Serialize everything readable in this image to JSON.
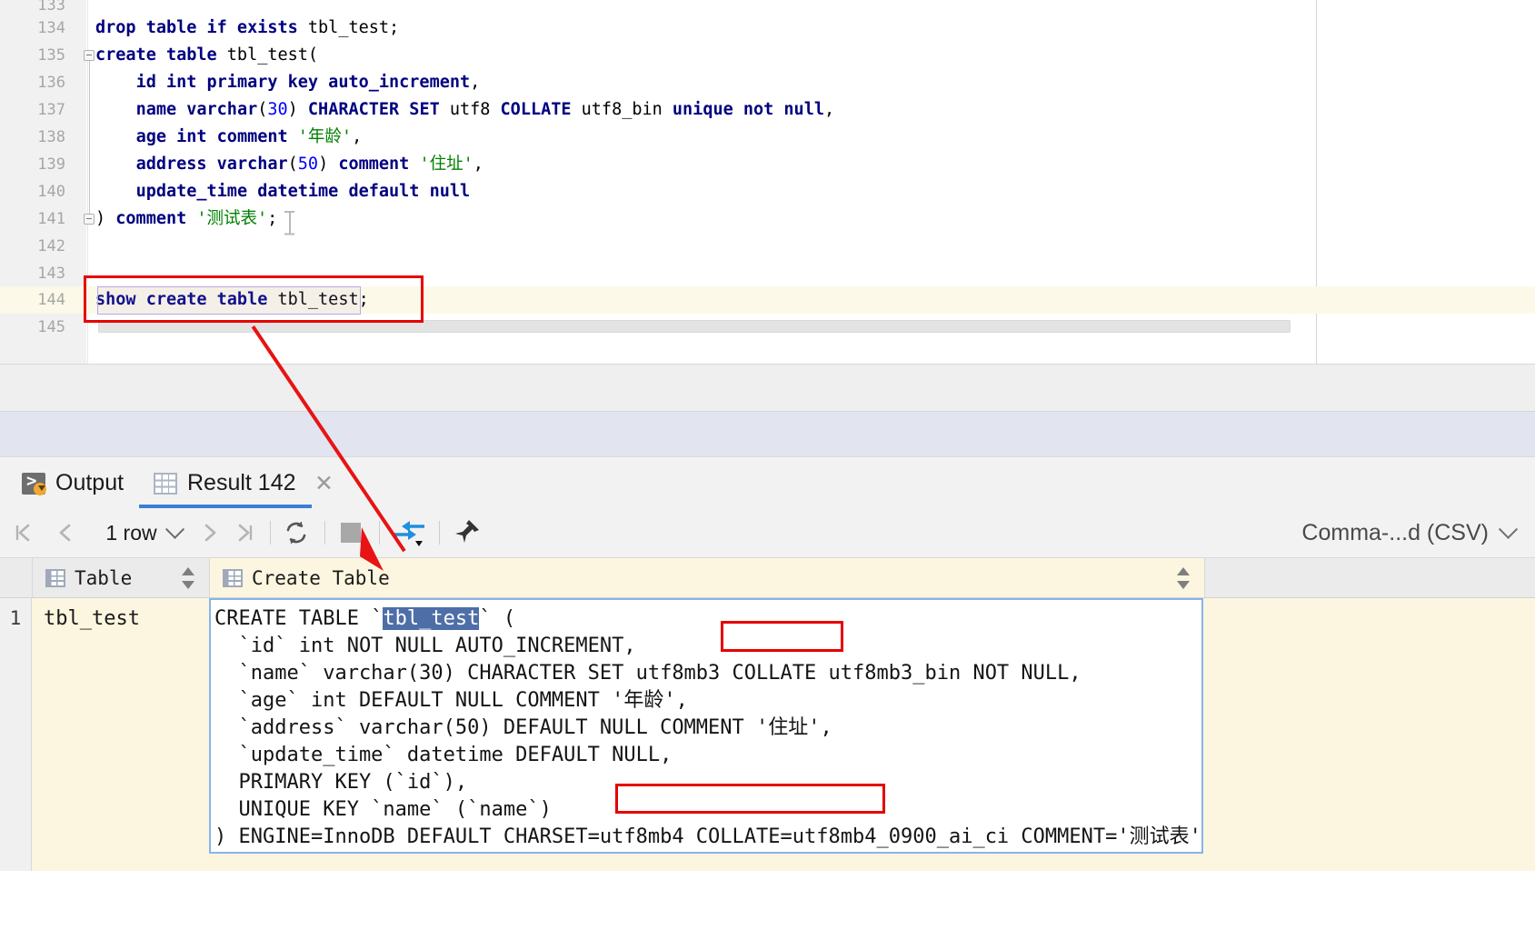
{
  "editor": {
    "lines": [
      {
        "n": "133",
        "text": ""
      },
      {
        "n": "134",
        "text": "drop table if exists tbl_test;"
      },
      {
        "n": "135",
        "text": "create table tbl_test("
      },
      {
        "n": "136",
        "text": "    id int primary key auto_increment,"
      },
      {
        "n": "137",
        "text": "    name varchar(30) CHARACTER SET utf8 COLLATE utf8_bin unique not null,"
      },
      {
        "n": "138",
        "text": "    age int comment '年龄',"
      },
      {
        "n": "139",
        "text": "    address varchar(50) comment '住址',"
      },
      {
        "n": "140",
        "text": "    update_time datetime default null"
      },
      {
        "n": "141",
        "text": ") comment '测试表';"
      },
      {
        "n": "142",
        "text": ""
      },
      {
        "n": "143",
        "text": ""
      },
      {
        "n": "144",
        "text": "show create table tbl_test;"
      },
      {
        "n": "145",
        "text": ""
      }
    ],
    "highlighted_line_number": "144",
    "highlighted_statement": "show create table tbl_test;"
  },
  "tabs": [
    {
      "label": "Output",
      "icon": "console-output-icon",
      "active": false,
      "closable": false
    },
    {
      "label": "Result 142",
      "icon": "grid-table-icon",
      "active": true,
      "closable": true,
      "close_glyph": "✕"
    }
  ],
  "result_toolbar": {
    "first_page_glyph": "|‹",
    "prev_page_glyph": "‹",
    "row_count_label": "1 row",
    "next_page_glyph": "›",
    "last_page_glyph": "›|",
    "refresh_icon": "refresh-icon",
    "stop_icon": "stop-icon",
    "transpose_icon": "import-export-icon",
    "pin_icon": "pin-icon",
    "export_format": "Comma-...d (CSV)",
    "export_chevron": "⌄"
  },
  "result_table": {
    "columns": [
      {
        "label": "Table",
        "icon": "column-grid-icon",
        "sortable": true
      },
      {
        "label": "Create Table",
        "icon": "column-grid-icon",
        "sortable": true
      }
    ],
    "rows": [
      {
        "number": "1",
        "table": "tbl_test",
        "create_table_lines": [
          "CREATE TABLE `tbl_test` (",
          "  `id` int NOT NULL AUTO_INCREMENT,",
          "  `name` varchar(30) CHARACTER SET utf8mb3 COLLATE utf8mb3_bin NOT NULL,",
          "  `age` int DEFAULT NULL COMMENT '年龄',",
          "  `address` varchar(50) DEFAULT NULL COMMENT '住址',",
          "  `update_time` datetime DEFAULT NULL,",
          "  PRIMARY KEY (`id`),",
          "  UNIQUE KEY `name` (`name`)",
          ") ENGINE=InnoDB DEFAULT CHARSET=utf8mb4 COLLATE=utf8mb4_0900_ai_ci COMMENT='测试表'"
        ],
        "selected_token": "tbl_test"
      }
    ]
  },
  "annotations": {
    "accent_color": "#e60000",
    "boxes": [
      {
        "name": "statement-highlight-box",
        "target": "show create table tbl_test;"
      },
      {
        "name": "collate-name-highlight-box",
        "target": "utf8mb3_bin"
      },
      {
        "name": "collate-table-highlight-box",
        "target": "COLLATE=utf8mb4_0900_ai_ci"
      }
    ],
    "arrow": {
      "name": "statement-to-result-arrow",
      "from": "show create table tbl_test;",
      "to": "Create Table cell"
    }
  },
  "colors": {
    "keyword": "#000080",
    "string": "#008000",
    "number": "#0000ff",
    "highlight_row": "#fcf9e8",
    "tab_active_underline": "#3a7fd5",
    "cell_border": "#8ab4e8",
    "selection": "#4e6ea8"
  }
}
